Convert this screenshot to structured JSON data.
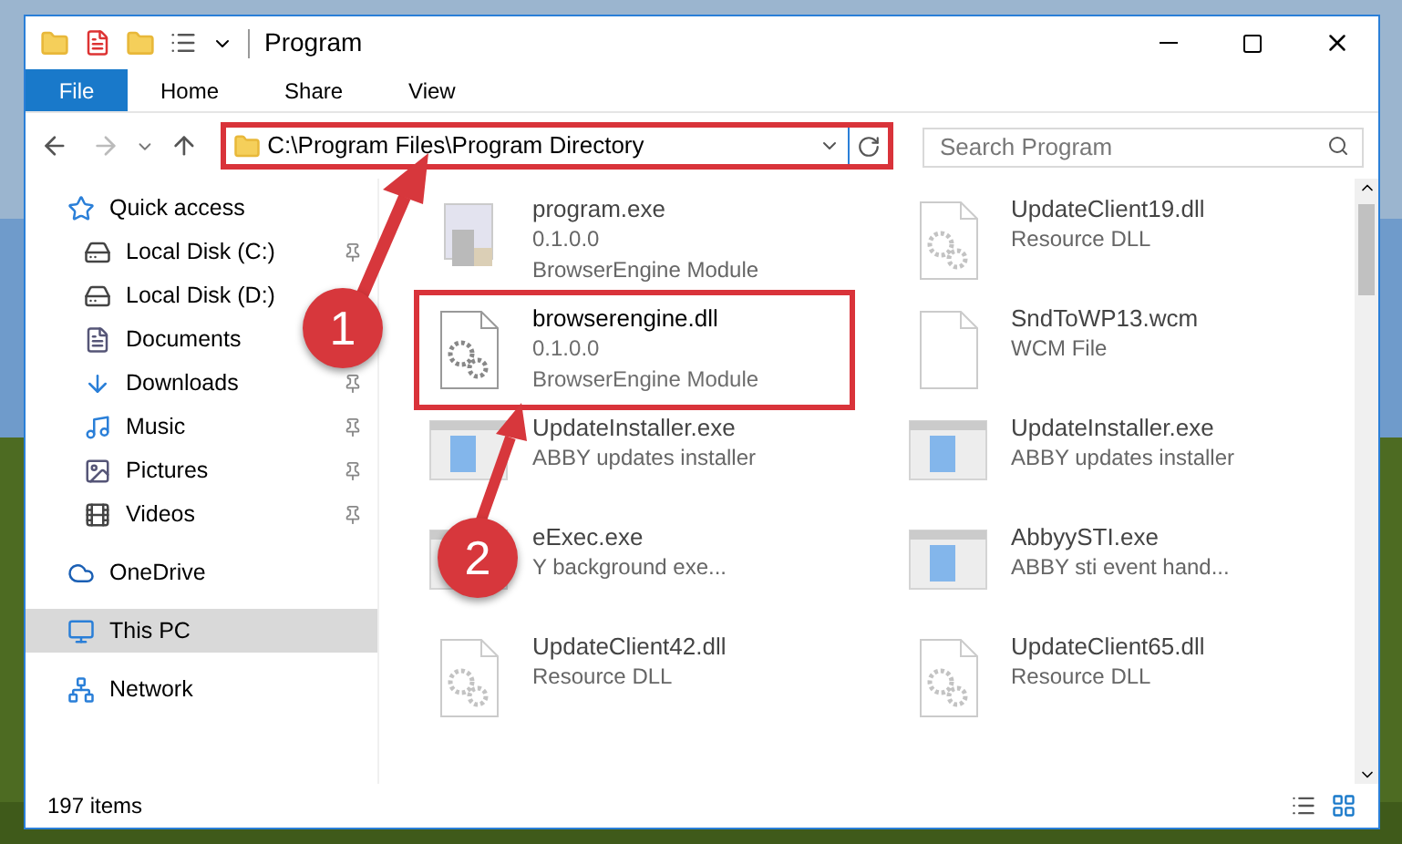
{
  "window": {
    "title": "Program"
  },
  "ribbon_tabs": [
    {
      "label": "File",
      "selected": true
    },
    {
      "label": "Home",
      "selected": false
    },
    {
      "label": "Share",
      "selected": false
    },
    {
      "label": "View",
      "selected": false
    }
  ],
  "address": {
    "value": "C:\\Program Files\\Program Directory",
    "highlighted": true
  },
  "search": {
    "placeholder": "Search Program"
  },
  "sidebar": {
    "items": [
      {
        "label": "Quick access",
        "kind": "star",
        "pinned": false,
        "selected": false,
        "group": true
      },
      {
        "label": "Local Disk (C:)",
        "kind": "disk-c",
        "pinned": true,
        "selected": false,
        "group": false
      },
      {
        "label": "Local Disk (D:)",
        "kind": "disk",
        "pinned": false,
        "selected": false,
        "group": false
      },
      {
        "label": "Documents",
        "kind": "documents",
        "pinned": false,
        "selected": false,
        "group": false
      },
      {
        "label": "Downloads",
        "kind": "downloads",
        "pinned": true,
        "selected": false,
        "group": false
      },
      {
        "label": "Music",
        "kind": "music",
        "pinned": true,
        "selected": false,
        "group": false
      },
      {
        "label": "Pictures",
        "kind": "pictures",
        "pinned": true,
        "selected": false,
        "group": false
      },
      {
        "label": "Videos",
        "kind": "videos",
        "pinned": true,
        "selected": false,
        "group": false
      },
      {
        "label": "OneDrive",
        "kind": "cloud",
        "pinned": false,
        "selected": false,
        "group": true
      },
      {
        "label": "This PC",
        "kind": "pc",
        "pinned": false,
        "selected": true,
        "group": true
      },
      {
        "label": "Network",
        "kind": "network",
        "pinned": false,
        "selected": false,
        "group": true
      }
    ]
  },
  "files": [
    {
      "name": "program.exe",
      "lines": [
        "0.1.0.0",
        "BrowserEngine Module"
      ],
      "kind": "program",
      "blurred": true,
      "highlighted": false
    },
    {
      "name": "UpdateClient19.dll",
      "lines": [
        "Resource DLL"
      ],
      "kind": "dll",
      "blurred": true,
      "highlighted": false
    },
    {
      "name": "browserengine.dll",
      "lines": [
        "0.1.0.0",
        "BrowserEngine Module"
      ],
      "kind": "dll",
      "blurred": false,
      "highlighted": true
    },
    {
      "name": "SndToWP13.wcm",
      "lines": [
        "WCM File"
      ],
      "kind": "file",
      "blurred": true,
      "highlighted": false
    },
    {
      "name": "UpdateInstaller.exe",
      "lines": [
        "ABBY updates installer"
      ],
      "kind": "app",
      "blurred": true,
      "highlighted": false
    },
    {
      "name": "UpdateInstaller.exe",
      "lines": [
        "ABBY updates installer"
      ],
      "kind": "app",
      "blurred": true,
      "highlighted": false
    },
    {
      "name": "eExec.exe",
      "lines": [
        "Y background exe..."
      ],
      "kind": "app",
      "blurred": true,
      "highlighted": false
    },
    {
      "name": "AbbyySTI.exe",
      "lines": [
        "ABBY sti event hand..."
      ],
      "kind": "app",
      "blurred": true,
      "highlighted": false
    },
    {
      "name": "UpdateClient42.dll",
      "lines": [
        "Resource DLL"
      ],
      "kind": "dll",
      "blurred": true,
      "highlighted": false
    },
    {
      "name": "UpdateClient65.dll",
      "lines": [
        "Resource DLL"
      ],
      "kind": "dll",
      "blurred": true,
      "highlighted": false
    }
  ],
  "status_bar": {
    "count": "197 items"
  },
  "annotations": [
    {
      "label": "1"
    },
    {
      "label": "2"
    }
  ]
}
